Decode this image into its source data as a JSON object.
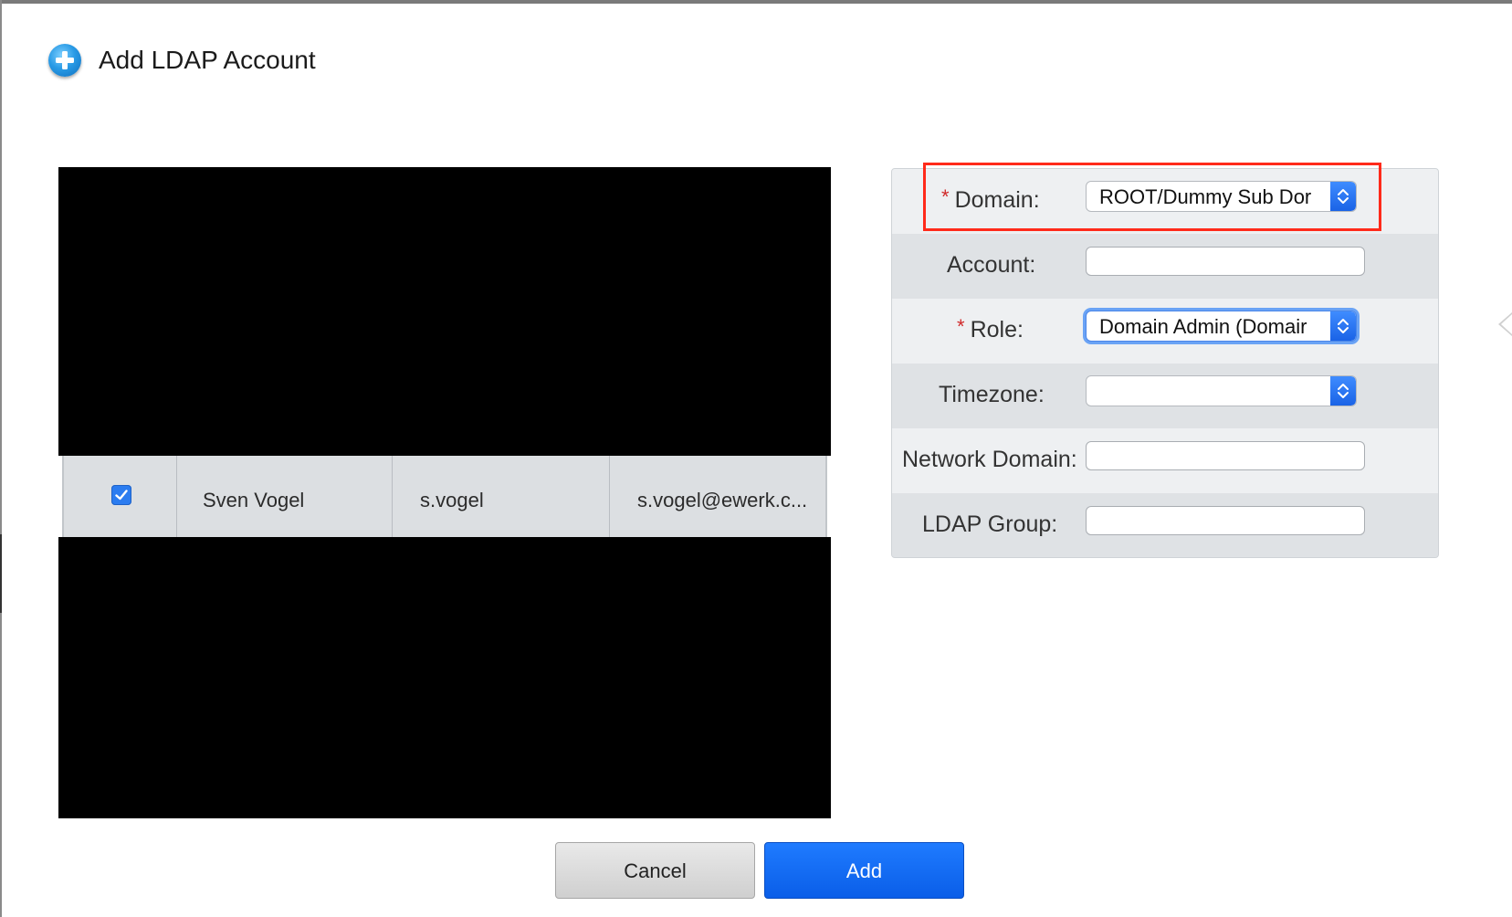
{
  "dialog": {
    "title": "Add LDAP Account"
  },
  "table": {
    "row": {
      "checked": true,
      "name": "Sven Vogel",
      "username": "s.vogel",
      "email": "s.vogel@ewerk.c..."
    }
  },
  "form": {
    "domain": {
      "label": "Domain:",
      "required_mark": "*",
      "value": "ROOT/Dummy Sub Dor"
    },
    "account": {
      "label": "Account:",
      "value": ""
    },
    "role": {
      "label": "Role:",
      "required_mark": "*",
      "value": "Domain Admin (Domair"
    },
    "timezone": {
      "label": "Timezone:",
      "value": ""
    },
    "network_domain": {
      "label": "Network Domain:",
      "value": ""
    },
    "ldap_group": {
      "label": "LDAP Group:",
      "value": ""
    }
  },
  "buttons": {
    "cancel": "Cancel",
    "add": "Add"
  },
  "colors": {
    "primary": "#0a5ee8",
    "required": "#d02a2a",
    "highlight": "#ff2a1a"
  },
  "icons": {
    "title": "add-circle-icon",
    "select": "chevron-up-down-icon",
    "checkbox": "checkmark-icon"
  }
}
